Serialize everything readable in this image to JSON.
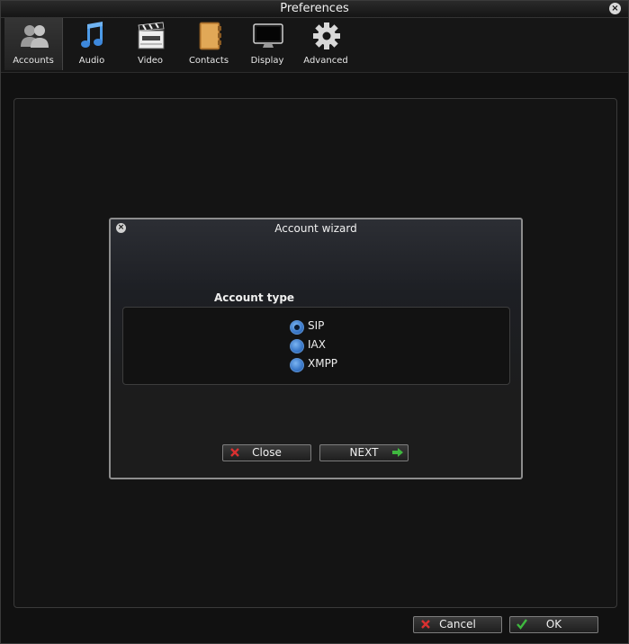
{
  "window": {
    "title": "Preferences"
  },
  "toolbar": {
    "items": [
      {
        "label": "Accounts",
        "icon": "accounts-icon"
      },
      {
        "label": "Audio",
        "icon": "music-note-icon"
      },
      {
        "label": "Video",
        "icon": "clapperboard-icon"
      },
      {
        "label": "Contacts",
        "icon": "address-book-icon"
      },
      {
        "label": "Display",
        "icon": "monitor-icon"
      },
      {
        "label": "Advanced",
        "icon": "gear-icon"
      }
    ],
    "active": "Accounts"
  },
  "wizard": {
    "title": "Account wizard",
    "section_label": "Account type",
    "options": [
      {
        "label": "SIP",
        "checked": true
      },
      {
        "label": "IAX",
        "checked": false
      },
      {
        "label": "XMPP",
        "checked": false
      }
    ],
    "close_label": "Close",
    "next_label": "NEXT"
  },
  "footer": {
    "cancel_label": "Cancel",
    "ok_label": "OK"
  },
  "colors": {
    "accent_blue": "#3a78c8",
    "cancel_red": "#d93030",
    "ok_green": "#3fb83f",
    "next_green": "#3fb83f"
  }
}
